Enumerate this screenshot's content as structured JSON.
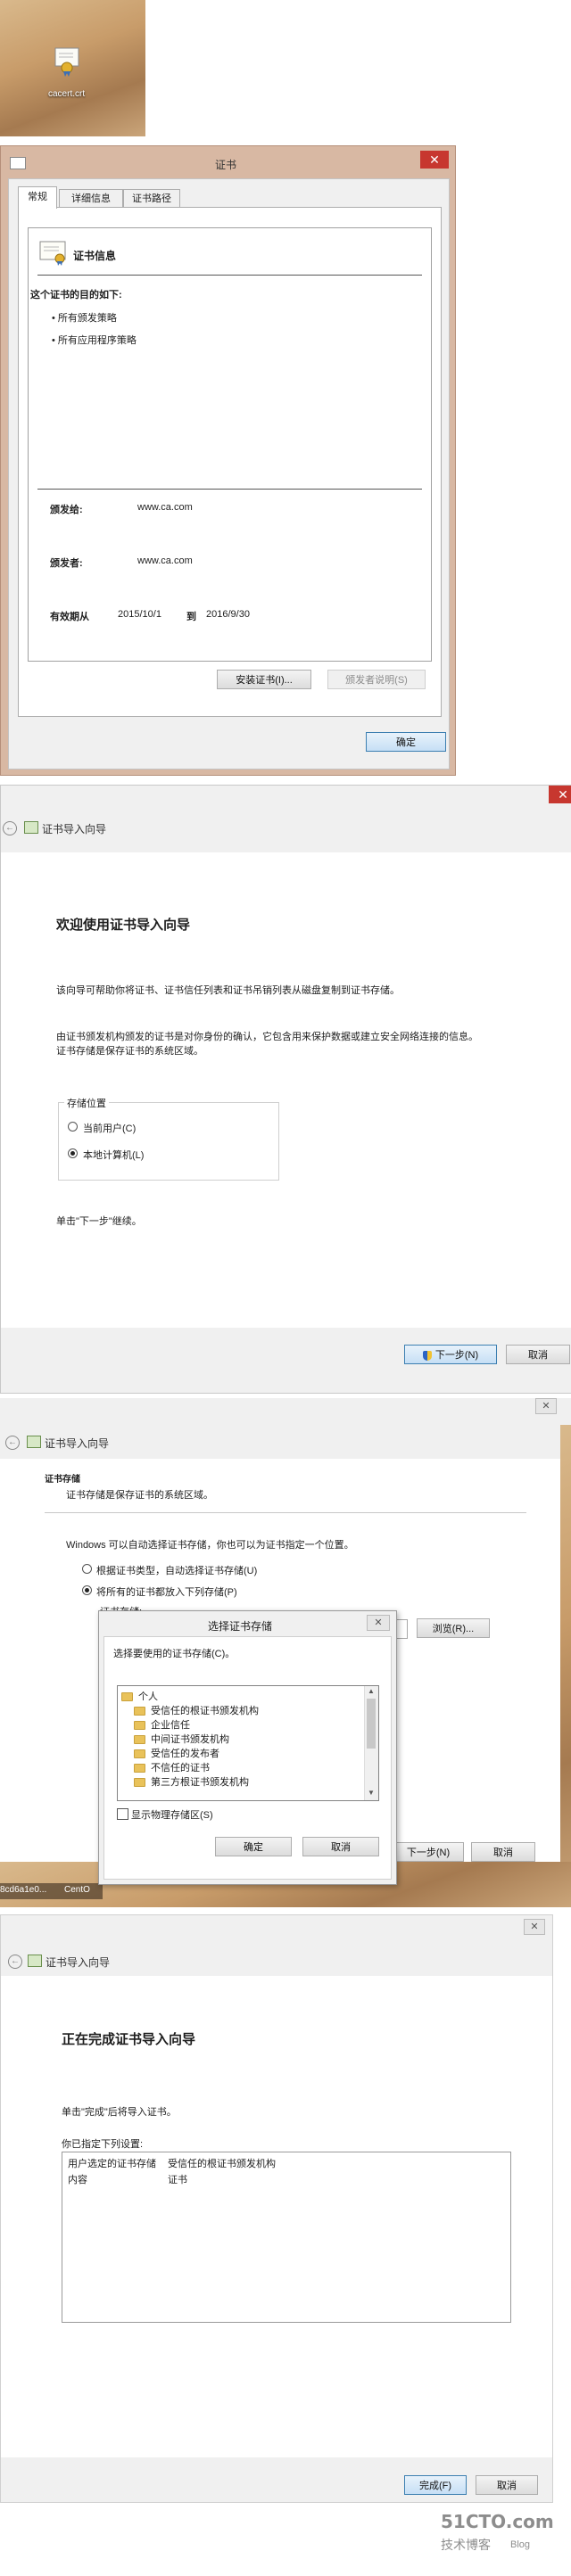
{
  "desktop_icon": {
    "label": "cacert.crt"
  },
  "cert_dialog": {
    "title": "证书",
    "tabs": [
      "常规",
      "详细信息",
      "证书路径"
    ],
    "info_title": "证书信息",
    "purpose_heading": "这个证书的目的如下:",
    "purposes": [
      "所有颁发策略",
      "所有应用程序策略"
    ],
    "issued_to_label": "颁发给:",
    "issued_to": "www.ca.com",
    "issued_by_label": "颁发者:",
    "issued_by": "www.ca.com",
    "valid_from_label": "有效期从",
    "valid_from": "2015/10/1",
    "valid_to_label": "到",
    "valid_to": "2016/9/30",
    "install_button": "安装证书(I)...",
    "issuer_statement_button": "颁发者说明(S)",
    "ok_button": "确定"
  },
  "wizard_welcome": {
    "title": "证书导入向导",
    "heading": "欢迎使用证书导入向导",
    "para1": "该向导可帮助你将证书、证书信任列表和证书吊销列表从磁盘复制到证书存储。",
    "para2_line1": "由证书颁发机构颁发的证书是对你身份的确认，它包含用来保护数据或建立安全网络连接的信息。",
    "para2_line2": "证书存储是保存证书的系统区域。",
    "store_location_label": "存储位置",
    "option_current_user": "当前用户(C)",
    "option_local_machine": "本地计算机(L)",
    "continue_hint": "单击\"下一步\"继续。",
    "next_button": "下一步(N)",
    "cancel_button": "取消"
  },
  "wizard_store": {
    "title": "证书导入向导",
    "section_title": "证书存储",
    "section_desc": "证书存储是保存证书的系统区域。",
    "intro": "Windows 可以自动选择证书存储，你也可以为证书指定一个位置。",
    "option_auto": "根据证书类型，自动选择证书存储(U)",
    "option_manual": "将所有的证书都放入下列存储(P)",
    "store_label": "证书存储:",
    "browse_button": "浏览(R)...",
    "next_button": "下一步(N)",
    "cancel_button": "取消",
    "taskbar_items": [
      "8cd6a1e0...",
      "CentO"
    ]
  },
  "select_store_dialog": {
    "title": "选择证书存储",
    "prompt": "选择要使用的证书存储(C)。",
    "stores": [
      "个人",
      "受信任的根证书颁发机构",
      "企业信任",
      "中间证书颁发机构",
      "受信任的发布者",
      "不信任的证书",
      "第三方根证书颁发机构"
    ],
    "show_physical": "显示物理存储区(S)",
    "ok_button": "确定",
    "cancel_button": "取消"
  },
  "wizard_finish": {
    "title": "证书导入向导",
    "heading": "正在完成证书导入向导",
    "hint": "单击\"完成\"后将导入证书。",
    "settings_label": "你已指定下列设置:",
    "rows": [
      {
        "key": "用户选定的证书存储",
        "value": "受信任的根证书颁发机构"
      },
      {
        "key": "内容",
        "value": "证书"
      }
    ],
    "finish_button": "完成(F)",
    "cancel_button": "取消"
  },
  "watermark": {
    "site": "51CTO.com",
    "slogan": "技术博客",
    "tag": "Blog"
  }
}
